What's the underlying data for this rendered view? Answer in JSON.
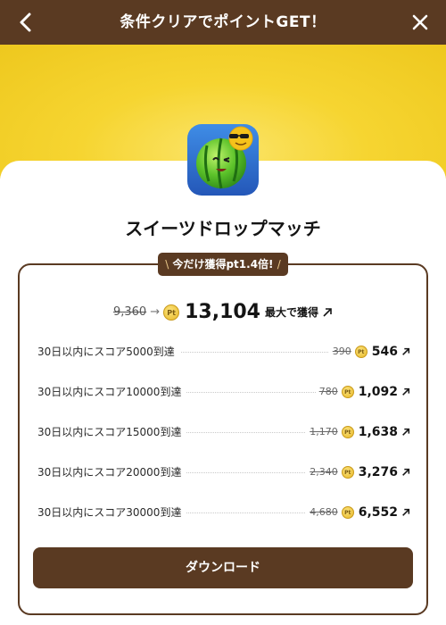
{
  "header": {
    "title": "条件クリアでポイントGET！"
  },
  "app": {
    "name": "スイーツドロップマッチ",
    "icon_name": "watermelon-app-icon"
  },
  "promo": {
    "badge": "今だけ獲得pt1.4倍!",
    "slash_left": "\\",
    "slash_right": "/"
  },
  "total": {
    "old": "9,360",
    "new": "13,104",
    "suffix": "最大で獲得",
    "coin_text": "Pt"
  },
  "tasks": [
    {
      "label": "30日以内にスコア5000到達",
      "old": "390",
      "new": "546"
    },
    {
      "label": "30日以内にスコア10000到達",
      "old": "780",
      "new": "1,092"
    },
    {
      "label": "30日以内にスコア15000到達",
      "old": "1,170",
      "new": "1,638"
    },
    {
      "label": "30日以内にスコア20000到達",
      "old": "2,340",
      "new": "3,276"
    },
    {
      "label": "30日以内にスコア30000到達",
      "old": "4,680",
      "new": "6,552"
    }
  ],
  "download": {
    "label": "ダウンロード"
  },
  "colors": {
    "brand_brown": "#5a3a22",
    "banner_yellow": "#f6d531"
  }
}
